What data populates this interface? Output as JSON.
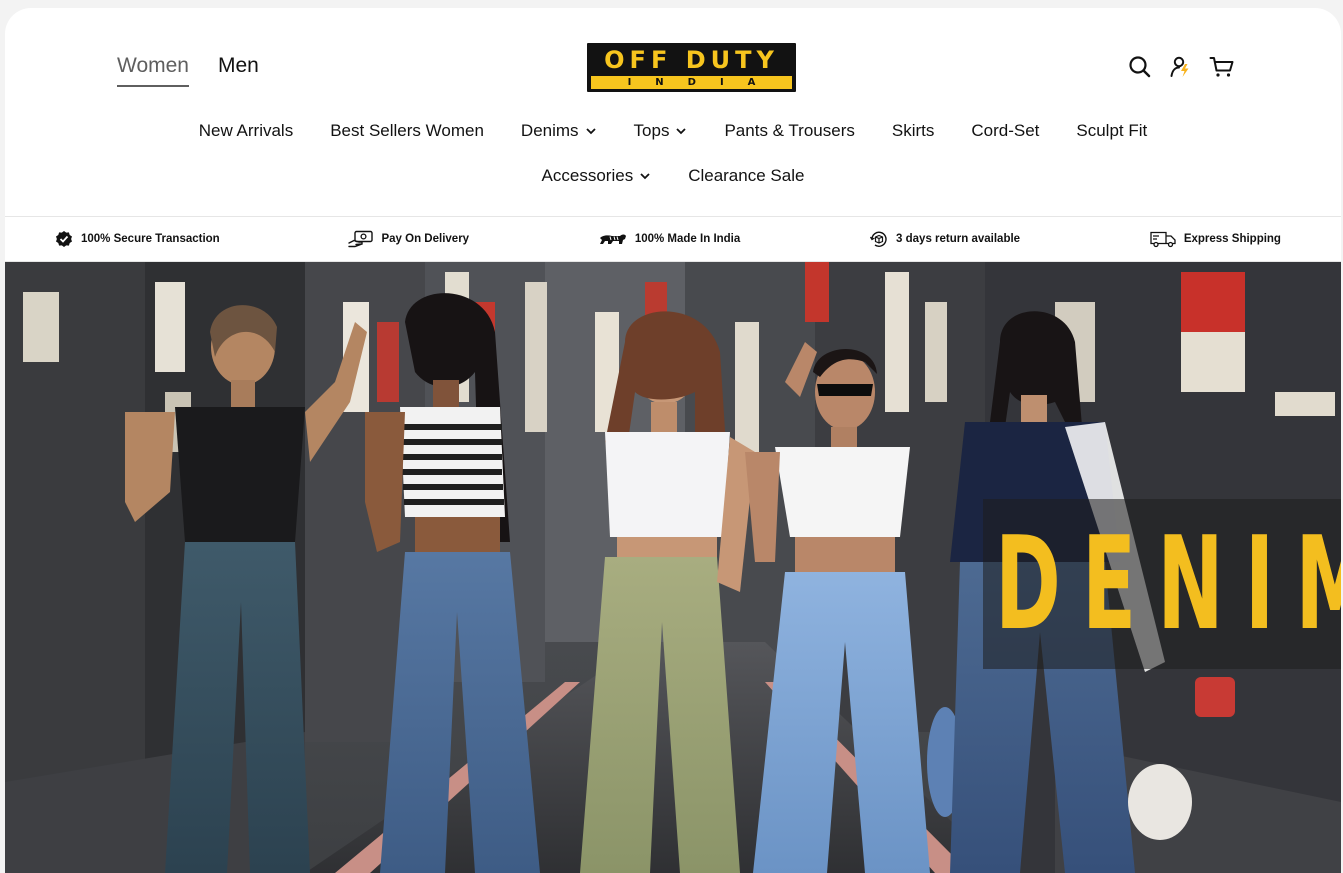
{
  "header": {
    "gender_tabs": [
      {
        "label": "Women",
        "active": true
      },
      {
        "label": "Men",
        "active": false
      }
    ],
    "logo": {
      "top_text": "OFF DUTY",
      "bottom_text": "INDIA"
    },
    "icons": [
      "search-icon",
      "account-icon",
      "cart-icon"
    ]
  },
  "nav": {
    "row1": [
      {
        "label": "New Arrivals",
        "dropdown": false
      },
      {
        "label": "Best Sellers Women",
        "dropdown": false
      },
      {
        "label": "Denims",
        "dropdown": true
      },
      {
        "label": "Tops",
        "dropdown": true
      },
      {
        "label": "Pants & Trousers",
        "dropdown": false
      },
      {
        "label": "Skirts",
        "dropdown": false
      },
      {
        "label": "Cord-Set",
        "dropdown": false
      },
      {
        "label": "Sculpt Fit",
        "dropdown": false
      }
    ],
    "row2": [
      {
        "label": "Accessories",
        "dropdown": true
      },
      {
        "label": "Clearance Sale",
        "dropdown": false
      }
    ]
  },
  "trust_bar": [
    {
      "icon": "verified-badge-icon",
      "label": "100% Secure Transaction"
    },
    {
      "icon": "cash-hand-icon",
      "label": "Pay On Delivery"
    },
    {
      "icon": "tiger-icon",
      "label": "100% Made In India"
    },
    {
      "icon": "return-box-icon",
      "label": "3 days return available"
    },
    {
      "icon": "delivery-truck-icon",
      "label": "Express Shipping"
    }
  ],
  "hero": {
    "title": "DENIM"
  },
  "colors": {
    "brand_yellow": "#f7c51e",
    "text_dark": "#121212",
    "tab_active": "#5f5f5f",
    "hero_title": "#f3be1f"
  }
}
